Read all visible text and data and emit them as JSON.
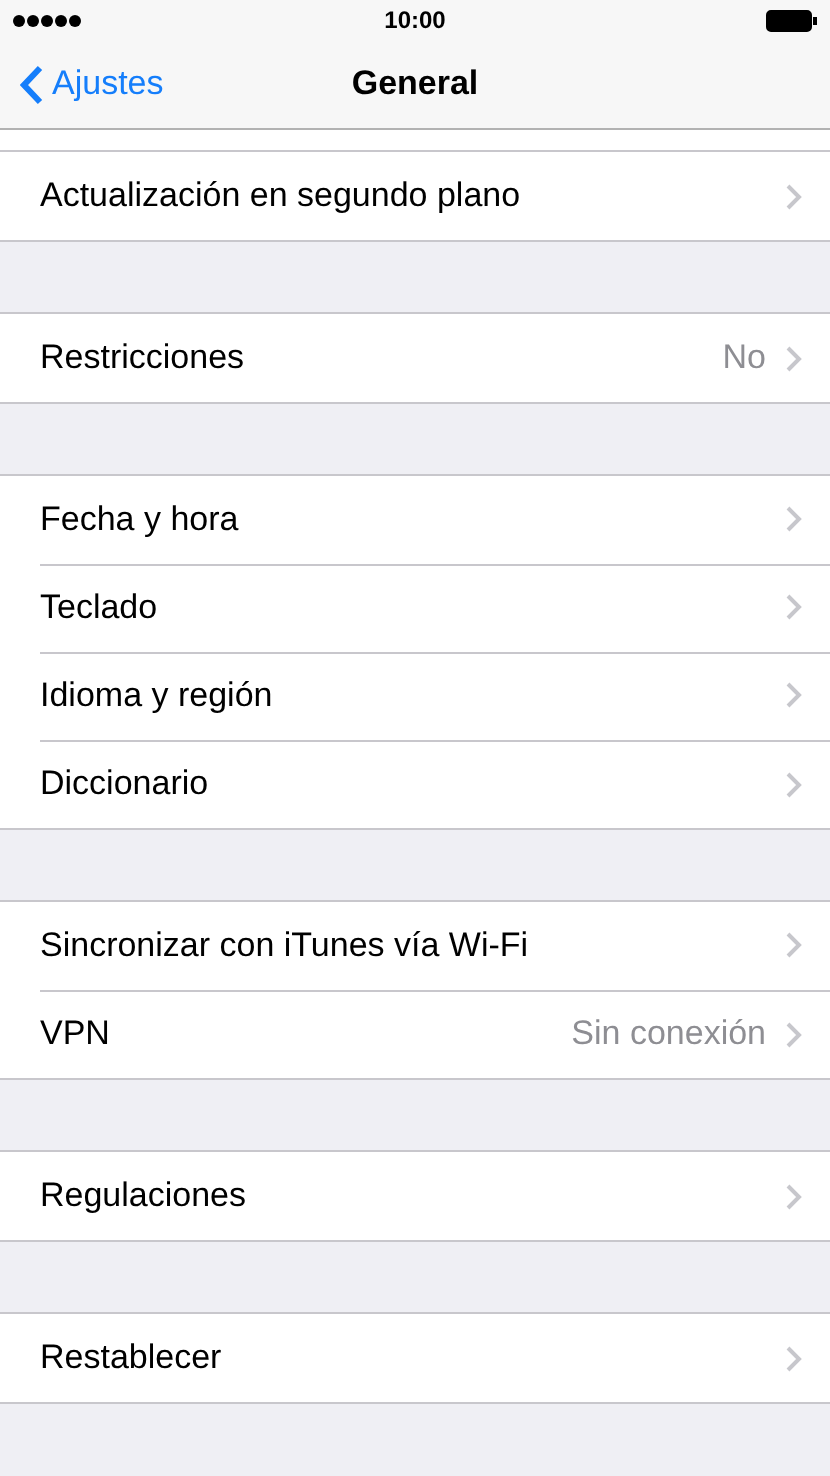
{
  "status_bar": {
    "time": "10:00"
  },
  "nav_bar": {
    "back_label": "Ajustes",
    "title": "General"
  },
  "sections": [
    {
      "rows": [
        {
          "label": "Actualización en segundo plano"
        }
      ]
    },
    {
      "rows": [
        {
          "label": "Restricciones",
          "value": "No"
        }
      ]
    },
    {
      "rows": [
        {
          "label": "Fecha y hora"
        },
        {
          "label": "Teclado"
        },
        {
          "label": "Idioma y región"
        },
        {
          "label": "Diccionario"
        }
      ]
    },
    {
      "rows": [
        {
          "label": "Sincronizar con iTunes vía Wi-Fi"
        },
        {
          "label": "VPN",
          "value": "Sin conexión"
        }
      ]
    },
    {
      "rows": [
        {
          "label": "Regulaciones"
        }
      ]
    },
    {
      "rows": [
        {
          "label": "Restablecer"
        }
      ]
    }
  ]
}
